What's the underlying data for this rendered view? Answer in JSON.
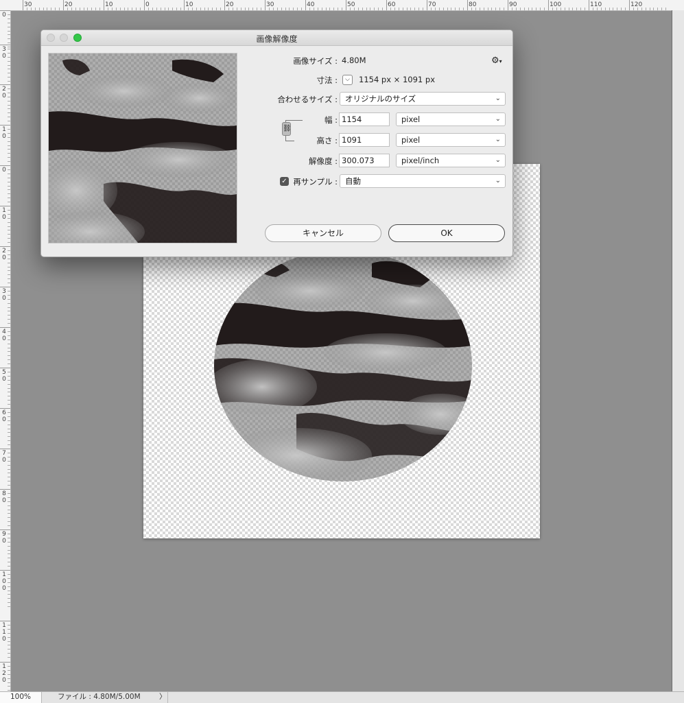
{
  "ruler": {
    "top_labels": [
      "30",
      "20",
      "10",
      "0",
      "10",
      "20",
      "30",
      "40",
      "50",
      "60",
      "70",
      "80",
      "90",
      "100",
      "110",
      "120"
    ],
    "left_labels": [
      "0",
      "3 0",
      "2 0",
      "1 0",
      "0",
      "1 0",
      "2 0",
      "3 0",
      "4 0",
      "5 0",
      "6 0",
      "7 0",
      "8 0",
      "9 0",
      "1 0 0",
      "1 1 0",
      "1 2 0"
    ]
  },
  "dialog": {
    "title": "画像解像度",
    "image_size_label": "画像サイズ :",
    "image_size_value": "4.80M",
    "dimensions_label": "寸法 :",
    "dimensions_value": "1154 px × 1091 px",
    "fit_to_label": "合わせるサイズ :",
    "fit_to_value": "オリジナルのサイズ",
    "width_label": "幅 :",
    "width_value": "1154",
    "width_unit": "pixel",
    "height_label": "高さ :",
    "height_value": "1091",
    "height_unit": "pixel",
    "resolution_label": "解像度 :",
    "resolution_value": "300.073",
    "resolution_unit": "pixel/inch",
    "resample_label": "再サンプル :",
    "resample_checked": true,
    "resample_value": "自動",
    "cancel_label": "キャンセル",
    "ok_label": "OK"
  },
  "statusbar": {
    "zoom": "100%",
    "file_info": "ファイル : 4.80M/5.00M",
    "arrow": "〉"
  },
  "icons": {
    "gear": "gear-icon",
    "link": "chain-link-icon",
    "chevron": "chevron-down-icon"
  }
}
